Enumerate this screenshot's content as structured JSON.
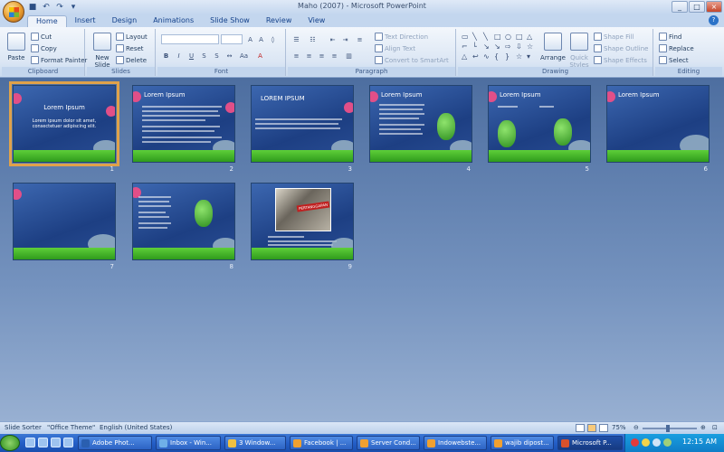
{
  "window": {
    "title": "Maho (2007) - Microsoft PowerPoint",
    "btn_min": "_",
    "btn_max": "□",
    "btn_close": "×"
  },
  "tabs": [
    {
      "label": "Home",
      "active": true
    },
    {
      "label": "Insert"
    },
    {
      "label": "Design"
    },
    {
      "label": "Animations"
    },
    {
      "label": "Slide Show"
    },
    {
      "label": "Review"
    },
    {
      "label": "View"
    }
  ],
  "ribbon": {
    "clipboard": {
      "label": "Clipboard",
      "paste": "Paste",
      "cut": "Cut",
      "copy": "Copy",
      "format_painter": "Format Painter"
    },
    "slides": {
      "label": "Slides",
      "new_slide": "New Slide",
      "layout": "Layout",
      "reset": "Reset",
      "delete": "Delete"
    },
    "font": {
      "label": "Font"
    },
    "paragraph": {
      "label": "Paragraph",
      "text_direction": "Text Direction",
      "align_text": "Align Text",
      "smartart": "Convert to SmartArt"
    },
    "drawing": {
      "label": "Drawing",
      "arrange": "Arrange",
      "quick_styles": "Quick Styles",
      "shape_fill": "Shape Fill",
      "shape_outline": "Shape Outline",
      "shape_effects": "Shape Effects"
    },
    "editing": {
      "label": "Editing",
      "find": "Find",
      "replace": "Replace",
      "select": "Select"
    }
  },
  "slides": [
    {
      "num": "1",
      "title": "Lorem Ipsum",
      "body": "Lorem ipsum dolor sit amet, consectetuer adipiscing elit.",
      "selected": true
    },
    {
      "num": "2",
      "title": "Lorem Ipsum"
    },
    {
      "num": "3",
      "title": "LOREM IPSUM"
    },
    {
      "num": "4",
      "title": "Lorem Ipsum"
    },
    {
      "num": "5",
      "title": "Lorem Ipsum"
    },
    {
      "num": "6",
      "title": "Lorem Ipsum"
    },
    {
      "num": "7"
    },
    {
      "num": "8"
    },
    {
      "num": "9",
      "caption": "PERTANGGAPAN"
    }
  ],
  "status": {
    "view": "Slide Sorter",
    "theme": "\"Office Theme\"",
    "language": "English (United States)",
    "zoom": "75%"
  },
  "taskbar": {
    "items": [
      {
        "label": "Adobe Phot..."
      },
      {
        "label": "Inbox - Win..."
      },
      {
        "label": "3 Window..."
      },
      {
        "label": "Facebook | ..."
      },
      {
        "label": "Server Cond..."
      },
      {
        "label": "Indowebste..."
      },
      {
        "label": "wajib dipost..."
      },
      {
        "label": "Microsoft P...",
        "active": true
      }
    ],
    "clock": "12:15 AM"
  }
}
